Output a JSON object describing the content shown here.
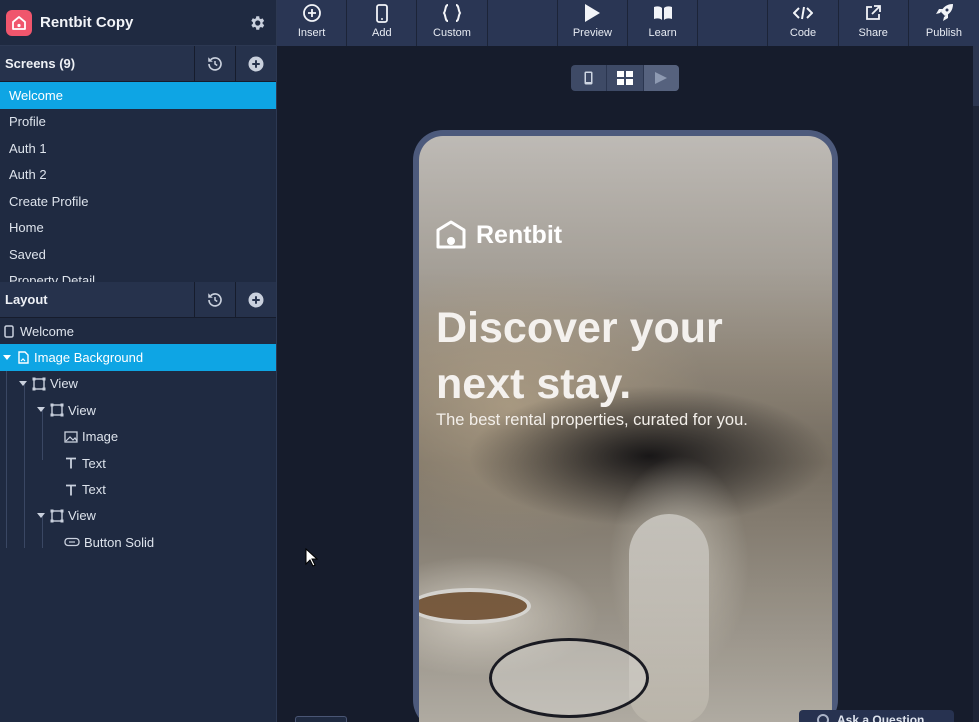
{
  "app": {
    "name": "Rentbit Copy"
  },
  "toolbar": {
    "items": [
      {
        "label": "Insert",
        "icon": "plus-circle-icon"
      },
      {
        "label": "Add",
        "icon": "phone-icon"
      },
      {
        "label": "Custom",
        "icon": "braces-icon"
      },
      {
        "label": "Preview",
        "icon": "play-icon"
      },
      {
        "label": "Learn",
        "icon": "book-icon"
      },
      {
        "label": "Code",
        "icon": "code-icon"
      },
      {
        "label": "Share",
        "icon": "external-link-icon"
      },
      {
        "label": "Publish",
        "icon": "rocket-icon"
      }
    ]
  },
  "screens": {
    "title": "Screens (9)",
    "items": [
      {
        "label": "Welcome",
        "active": true
      },
      {
        "label": "Profile"
      },
      {
        "label": "Auth 1"
      },
      {
        "label": "Auth 2"
      },
      {
        "label": "Create Profile"
      },
      {
        "label": "Home"
      },
      {
        "label": "Saved"
      },
      {
        "label": "Property Detail"
      }
    ]
  },
  "layout": {
    "title": "Layout",
    "tree": [
      {
        "label": "Welcome",
        "type": "screen"
      },
      {
        "label": "Image Background",
        "type": "image-bg",
        "active": true
      },
      {
        "label": "View",
        "type": "view"
      },
      {
        "label": "View",
        "type": "view"
      },
      {
        "label": "Image",
        "type": "image"
      },
      {
        "label": "Text",
        "type": "text"
      },
      {
        "label": "Text",
        "type": "text"
      },
      {
        "label": "View",
        "type": "view"
      },
      {
        "label": "Button Solid",
        "type": "button"
      }
    ]
  },
  "preview": {
    "brand": "Rentbit",
    "headline": "Discover your next stay.",
    "subline": "The best rental properties, curated for you."
  },
  "help": {
    "label": "Ask a Question"
  },
  "colors": {
    "accent": "#0ea5e4",
    "logo": "#f0566d",
    "sidebar": "#1f2a41",
    "toolbar": "#2a3654",
    "canvas": "#161c2c"
  }
}
